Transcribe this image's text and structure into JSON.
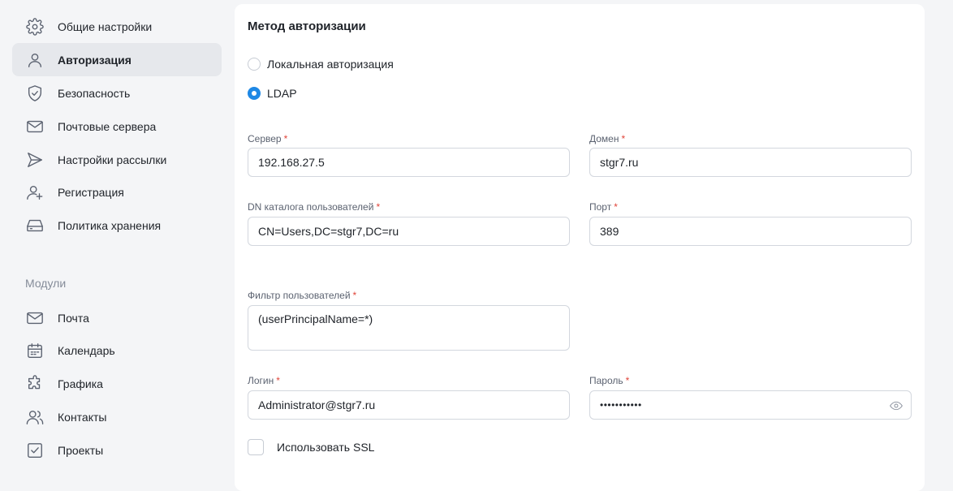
{
  "sidebar": {
    "items": [
      {
        "label": "Общие настройки",
        "icon": "gear-icon"
      },
      {
        "label": "Авторизация",
        "icon": "user-icon"
      },
      {
        "label": "Безопасность",
        "icon": "shield-check-icon"
      },
      {
        "label": "Почтовые сервера",
        "icon": "envelope-icon"
      },
      {
        "label": "Настройки рассылки",
        "icon": "send-icon"
      },
      {
        "label": "Регистрация",
        "icon": "user-plus-icon"
      },
      {
        "label": "Политика хранения",
        "icon": "storage-icon"
      }
    ],
    "modules_label": "Модули",
    "modules": [
      {
        "label": "Почта",
        "icon": "envelope-icon"
      },
      {
        "label": "Календарь",
        "icon": "calendar-icon"
      },
      {
        "label": "Графика",
        "icon": "puzzle-icon"
      },
      {
        "label": "Контакты",
        "icon": "users-icon"
      },
      {
        "label": "Проекты",
        "icon": "checkbox-icon"
      }
    ],
    "active_item": "Авторизация"
  },
  "main": {
    "title": "Метод авторизации",
    "auth_options": [
      {
        "label": "Локальная авторизация",
        "selected": false
      },
      {
        "label": "LDAP",
        "selected": true
      }
    ],
    "fields": {
      "server": {
        "label": "Сервер",
        "value": "192.168.27.5"
      },
      "domain": {
        "label": "Домен",
        "value": "stgr7.ru"
      },
      "dn": {
        "label": "DN каталога пользователей",
        "value": "CN=Users,DC=stgr7,DC=ru"
      },
      "port": {
        "label": "Порт",
        "value": "389"
      },
      "filter": {
        "label": "Фильтр пользователей",
        "value": "(userPrincipalName=*)"
      },
      "login": {
        "label": "Логин",
        "value": "Administrator@stgr7.ru"
      },
      "password": {
        "label": "Пароль",
        "value": "•••••••••••"
      }
    },
    "required_mark": "*",
    "ssl_label": "Использовать SSL",
    "ssl_checked": false
  },
  "colors": {
    "accent": "#1e88e5",
    "required": "#e0453a",
    "active_bg": "#e6e8ec",
    "page_bg": "#f4f5f7"
  }
}
